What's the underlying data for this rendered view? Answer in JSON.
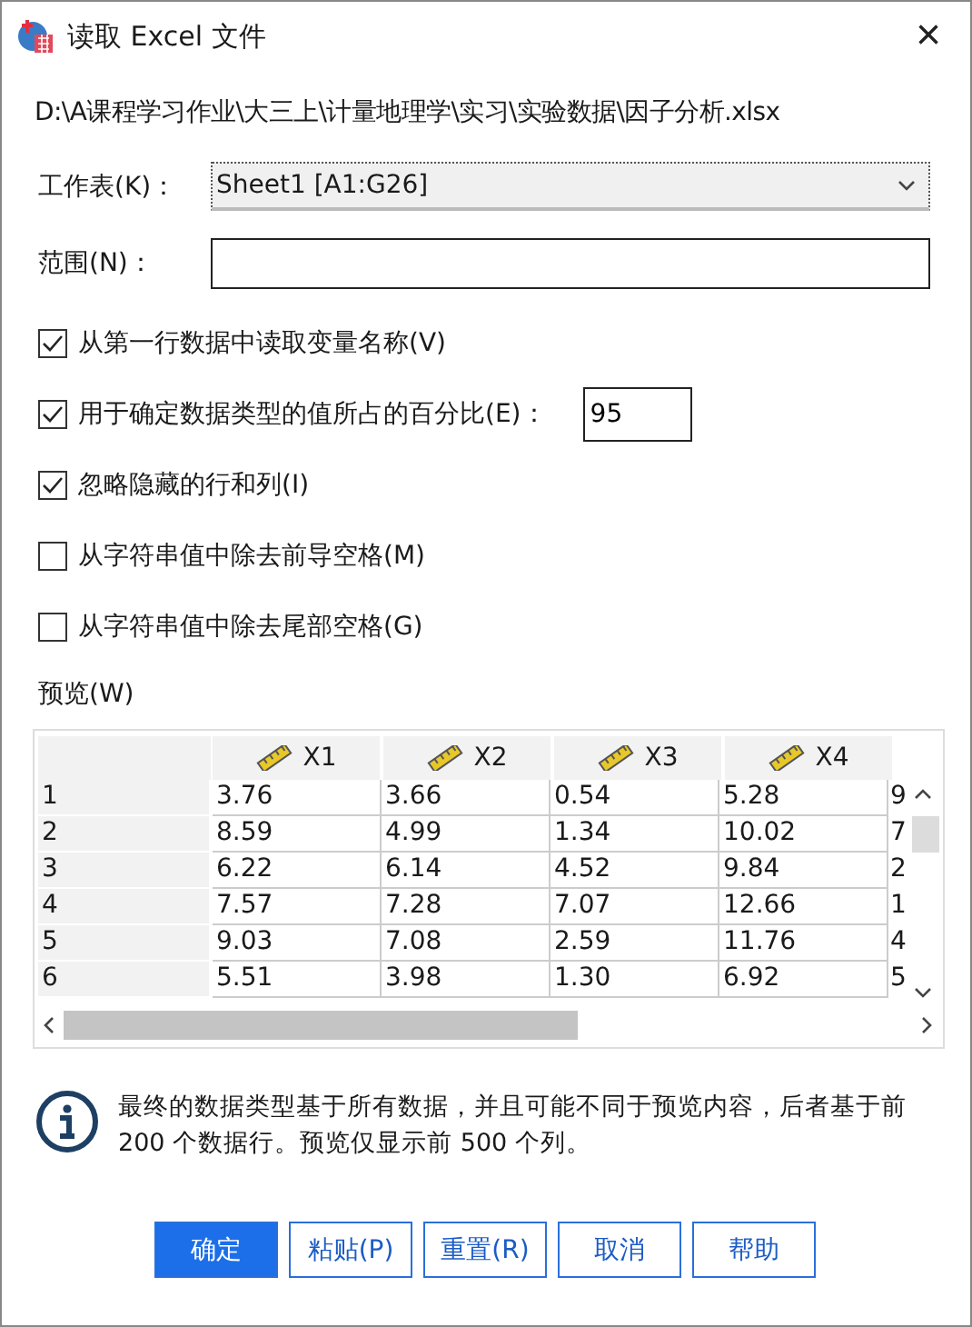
{
  "window": {
    "title": "读取 Excel 文件",
    "close": "×"
  },
  "path": "D:\\A课程学习作业\\大三上\\计量地理学\\实习\\实验数据\\因子分析.xlsx",
  "worksheet": {
    "label": "工作表(K)：",
    "value": "Sheet1 [A1:G26]"
  },
  "range": {
    "label": "范围(N)："
  },
  "options": [
    {
      "label": "从第一行数据中读取变量名称(V)",
      "checked": true
    },
    {
      "label": "用于确定数据类型的值所占的百分比(E)：",
      "checked": true,
      "value": "95"
    },
    {
      "label": "忽略隐藏的行和列(I)",
      "checked": true
    },
    {
      "label": "从字符串值中除去前导空格(M)",
      "checked": false
    },
    {
      "label": "从字符串值中除去尾部空格(G)",
      "checked": false
    }
  ],
  "preview": {
    "label": "预览(W)",
    "columns": [
      "X1",
      "X2",
      "X3",
      "X4"
    ],
    "rows": [
      [
        "1",
        "3.76",
        "3.66",
        "0.54",
        "5.28",
        "9"
      ],
      [
        "2",
        "8.59",
        "4.99",
        "1.34",
        "10.02",
        "7"
      ],
      [
        "3",
        "6.22",
        "6.14",
        "4.52",
        "9.84",
        "2"
      ],
      [
        "4",
        "7.57",
        "7.28",
        "7.07",
        "12.66",
        "1"
      ],
      [
        "5",
        "9.03",
        "7.08",
        "2.59",
        "11.76",
        "4"
      ],
      [
        "6",
        "5.51",
        "3.98",
        "1.30",
        "6.92",
        "5"
      ]
    ]
  },
  "info": "最终的数据类型基于所有数据，并且可能不同于预览内容，后者基于前 200 个数据行。预览仅显示前 500 个列。",
  "buttons": [
    {
      "label": "确定",
      "primary": true
    },
    {
      "label": "粘贴(P)",
      "primary": false
    },
    {
      "label": "重置(R)",
      "primary": false
    },
    {
      "label": "取消",
      "primary": false
    },
    {
      "label": "帮助",
      "primary": false
    }
  ]
}
